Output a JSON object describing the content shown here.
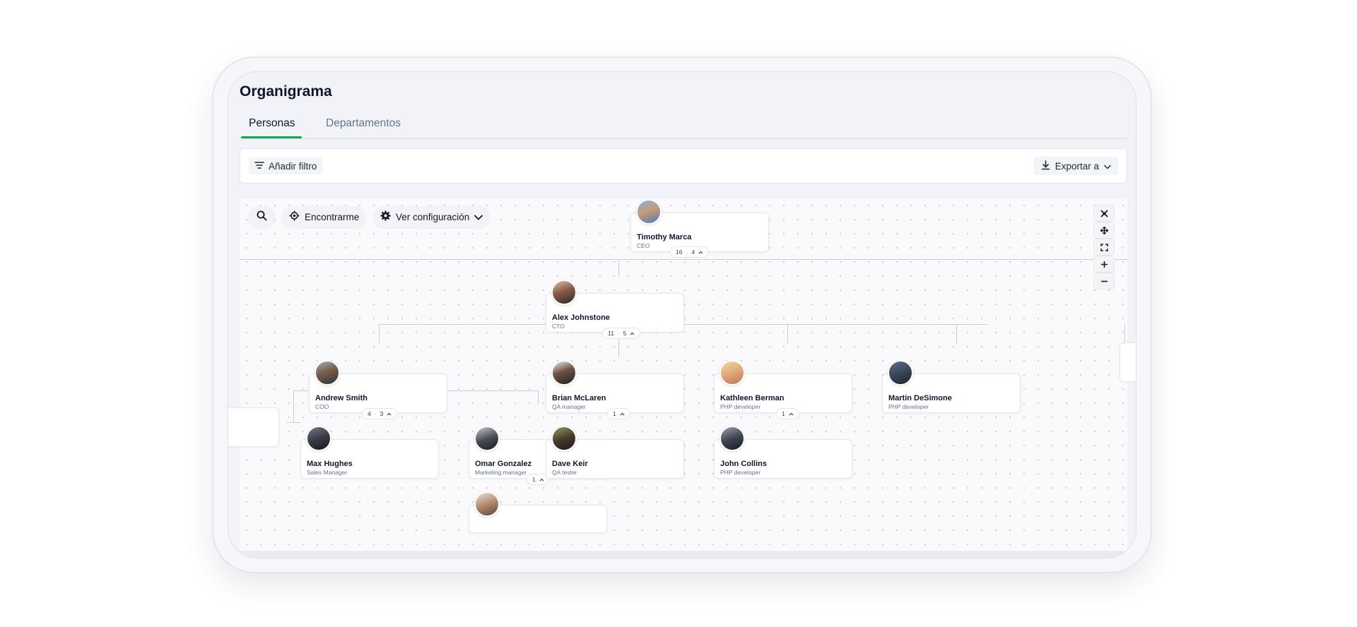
{
  "page": {
    "title": "Organigrama"
  },
  "tabs": [
    {
      "label": "Personas",
      "active": true
    },
    {
      "label": "Departamentos",
      "active": false
    }
  ],
  "filterbar": {
    "add_filter": "Añadir filtro",
    "export": "Exportar a"
  },
  "toolbar": {
    "search_icon": "search-icon",
    "find_me": "Encontrarme",
    "settings": "Ver configuración"
  },
  "zoom_controls": [
    "collapse-icon",
    "move-icon",
    "fullscreen-icon",
    "plus-icon",
    "minus-icon"
  ],
  "colors": {
    "accent": "#16a34a",
    "text": "#0f172a",
    "muted": "#64748b"
  },
  "nodes": {
    "timothy": {
      "name": "Timothy Marca",
      "role": "CEO",
      "badge_a": "16",
      "badge_b": "4"
    },
    "alex": {
      "name": "Alex Johnstone",
      "role": "CTO",
      "badge_a": "11",
      "badge_b": "5"
    },
    "andrew": {
      "name": "Andrew Smith",
      "role": "COO",
      "badge_a": "4",
      "badge_b": "3"
    },
    "brian": {
      "name": "Brian McLaren",
      "role": "QA manager",
      "badge_a": "1"
    },
    "kathleen": {
      "name": "Kathleen Berman",
      "role": "PHP developer",
      "badge_a": "1"
    },
    "martin": {
      "name": "Martin DeSimone",
      "role": "PHP developer"
    },
    "max": {
      "name": "Max Hughes",
      "role": "Sales Manager"
    },
    "omar": {
      "name": "Omar Gonzalez",
      "role": "Marketing manager",
      "badge_a": "1"
    },
    "dave": {
      "name": "Dave Keir",
      "role": "QA tester"
    },
    "john": {
      "name": "John Collins",
      "role": "PHP developer"
    }
  }
}
